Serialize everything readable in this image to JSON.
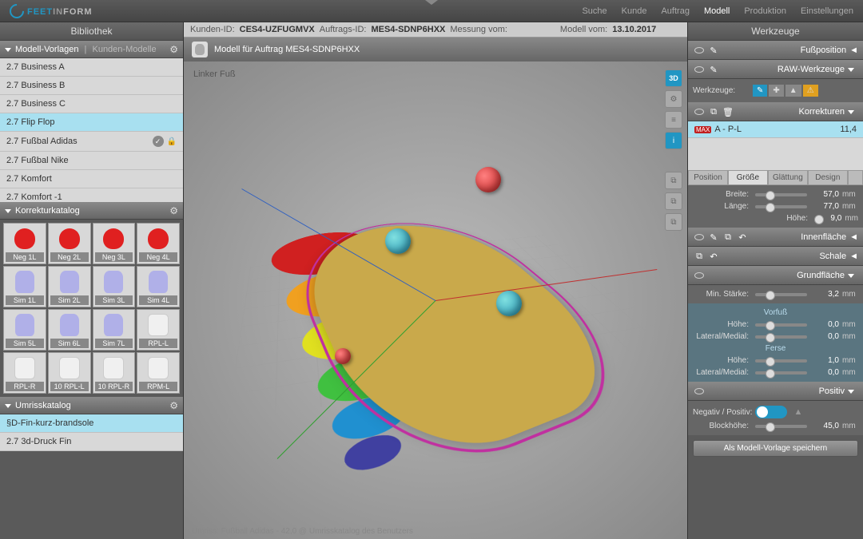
{
  "brand": {
    "feet": "FEET",
    "in": "IN",
    "form": "FORM"
  },
  "nav": {
    "suche": "Suche",
    "kunde": "Kunde",
    "auftrag": "Auftrag",
    "modell": "Modell",
    "produktion": "Produktion",
    "einstellungen": "Einstellungen"
  },
  "sidebar": {
    "title": "Bibliothek",
    "modellvorlagen": "Modell-Vorlagen",
    "kundenmodelle": "Kunden-Modelle",
    "templates": [
      "2.7 Business A",
      "2.7 Business B",
      "2.7 Business C",
      "2.7 Flip Flop",
      "2.7 Fußbal Adidas",
      "2.7 Fußbal Nike",
      "2.7 Komfort",
      "2.7 Komfort -1"
    ],
    "korrekturkatalog": "Korrekturkatalog",
    "catalog": [
      {
        "label": "Neg 1L",
        "t": "r"
      },
      {
        "label": "Neg 2L",
        "t": "r"
      },
      {
        "label": "Neg 3L",
        "t": "r"
      },
      {
        "label": "Neg 4L",
        "t": "r"
      },
      {
        "label": "Sim 1L",
        "t": "b"
      },
      {
        "label": "Sim 2L",
        "t": "b"
      },
      {
        "label": "Sim 3L",
        "t": "b"
      },
      {
        "label": "Sim 4L",
        "t": "b"
      },
      {
        "label": "Sim 5L",
        "t": "b"
      },
      {
        "label": "Sim 6L",
        "t": "b"
      },
      {
        "label": "Sim 7L",
        "t": "b"
      },
      {
        "label": "RPL-L",
        "t": "w"
      },
      {
        "label": "RPL-R",
        "t": "w"
      },
      {
        "label": "10 RPL-L",
        "t": "w"
      },
      {
        "label": "10 RPL-R",
        "t": "w"
      },
      {
        "label": "RPM-L",
        "t": "w"
      }
    ],
    "umrisskatalog": "Umrisskatalog",
    "umriss": [
      "§D-Fin-kurz-brandsole",
      "2.7 3d-Druck Fin"
    ]
  },
  "info": {
    "kundenid_lbl": "Kunden-ID:",
    "kundenid": "CES4-UZFUGMVX",
    "auftragsid_lbl": "Auftrags-ID:",
    "auftragsid": "MES4-SDNP6HXX",
    "messung_lbl": "Messung vom:",
    "modell_lbl": "Modell vom:",
    "modell_date": "13.10.2017"
  },
  "viewport": {
    "title": "Modell für Auftrag  MES4-SDNP6HXX",
    "label": "Linker Fuß",
    "footer": "Umriss:   Fußball Adidas - 42,0 @ Umrisskatalog des Benutzers",
    "btn3d": "3D"
  },
  "tools": {
    "title": "Werkzeuge",
    "fussposition": "Fußposition",
    "raw": "RAW-Werkzeuge",
    "werkzeuge_lbl": "Werkzeuge:",
    "korrekturen": "Korrekturen",
    "corr": {
      "name": "A - P-L",
      "val": "11,4"
    },
    "tabs": {
      "position": "Position",
      "groesse": "Größe",
      "glaettung": "Glättung",
      "design": "Design"
    },
    "breite": {
      "lbl": "Breite:",
      "val": "57,0",
      "unit": "mm"
    },
    "laenge": {
      "lbl": "Länge:",
      "val": "77,0",
      "unit": "mm"
    },
    "hoehe": {
      "lbl": "Höhe:",
      "val": "9,0",
      "unit": "mm"
    },
    "innenflaeche": "Innenfläche",
    "schale": "Schale",
    "grundflaeche": "Grundfläche",
    "minstaerke": {
      "lbl": "Min. Stärke:",
      "val": "3,2",
      "unit": "mm"
    },
    "vorfuss": "Vorfuß",
    "vf_hoehe": {
      "lbl": "Höhe:",
      "val": "0,0",
      "unit": "mm"
    },
    "vf_lm": {
      "lbl": "Lateral/Medial:",
      "val": "0,0",
      "unit": "mm"
    },
    "ferse": "Ferse",
    "fe_hoehe": {
      "lbl": "Höhe:",
      "val": "1,0",
      "unit": "mm"
    },
    "fe_lm": {
      "lbl": "Lateral/Medial:",
      "val": "0,0",
      "unit": "mm"
    },
    "positiv": "Positiv",
    "negpos": {
      "lbl": "Negativ / Positiv:"
    },
    "blockhoehe": {
      "lbl": "Blockhöhe:",
      "val": "45,0",
      "unit": "mm"
    },
    "save": "Als Modell-Vorlage speichern"
  }
}
